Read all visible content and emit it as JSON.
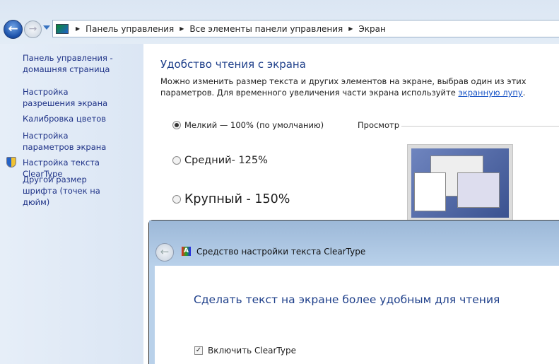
{
  "nav": {
    "breadcrumb": [
      "Панель управления",
      "Все элементы панели управления",
      "Экран"
    ]
  },
  "sidebar": {
    "items": [
      "Панель управления - домашняя страница",
      "Настройка разрешения экрана",
      "Калибровка цветов",
      "Настройка параметров экрана",
      "Настройка текста ClearType",
      "Другой размер шрифта (точек на дюйм)"
    ]
  },
  "main": {
    "title": "Удобство чтения с экрана",
    "description": "Можно изменить размер текста и других элементов на экране, выбрав один из этих параметров. Для временного увеличения части экрана используйте ",
    "magnifier_link": "экранную лупу",
    "period": ".",
    "options": [
      {
        "label": "Мелкий — 100% (по умолчанию)",
        "selected": true
      },
      {
        "label": "Средний- 125%",
        "selected": false
      },
      {
        "label": "Крупный - 150%",
        "selected": false
      }
    ],
    "preview_label": "Просмотр"
  },
  "cleartype": {
    "window_title": "Средство настройки текста ClearType",
    "heading": "Сделать текст на экране более удобным для чтения",
    "checkbox_label": "Включить ClearType",
    "checkbox_checked": true
  }
}
